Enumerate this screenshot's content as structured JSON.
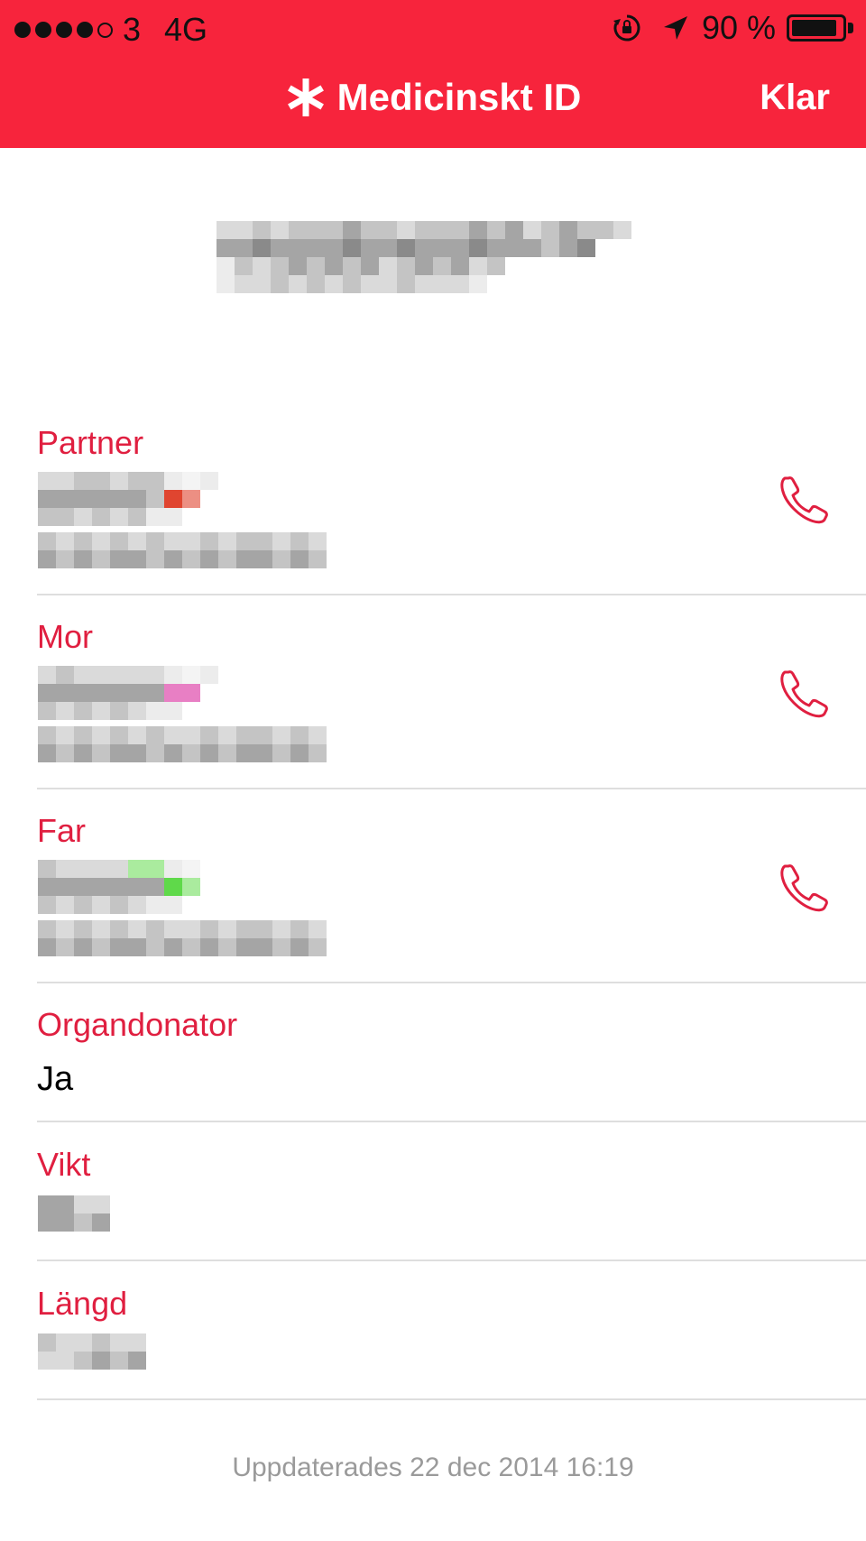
{
  "status_bar": {
    "signal_dots_filled": 4,
    "signal_dots_total": 5,
    "carrier": "3",
    "network": "4G",
    "battery_percent_text": "90 %",
    "battery_level": 0.9
  },
  "nav": {
    "title": "Medicinskt ID",
    "done_label": "Klar",
    "title_icon": "asterisk-icon"
  },
  "contacts": [
    {
      "label": "Partner"
    },
    {
      "label": "Mor"
    },
    {
      "label": "Far"
    }
  ],
  "organ_donor": {
    "label": "Organdonator",
    "value": "Ja"
  },
  "weight": {
    "label": "Vikt"
  },
  "height": {
    "label": "Längd"
  },
  "footer": {
    "updated": "Uppdaterades 22 dec 2014 16:19"
  },
  "colors": {
    "accent": "#f7243c",
    "label": "#e01f40",
    "divider": "#dedede",
    "footer": "#9a9a9a"
  }
}
